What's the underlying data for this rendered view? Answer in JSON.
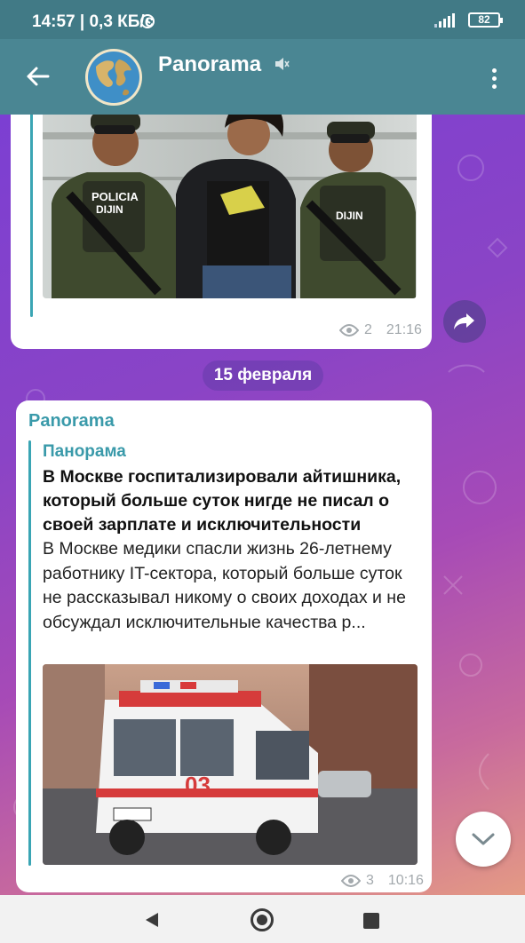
{
  "status_bar": {
    "time": "14:57 | 0,3 КБ/с",
    "battery": "82"
  },
  "header": {
    "title": "Panorama"
  },
  "messages": [
    {
      "views": "2",
      "time": "21:16"
    },
    {
      "forwarded_from": "Panorama",
      "source_name": "Панорама",
      "headline": "В Москве госпитализировали айтишника, который больше суток нигде не писал о своей зарплате и исключительности",
      "body": "В Москве медики спасли жизнь 26-летнему работнику IT-сектора, который больше суток не рассказывал никому о своих доходах и не обсуждал исключительные качества р...",
      "views": "3",
      "time": "10:16"
    }
  ],
  "date_separator": "15 февраля",
  "photo_labels": {
    "police_left": "POLICIA",
    "police_sub": "DIJIN",
    "police_right": "DIJIN",
    "ambulance_number": "03"
  },
  "colors": {
    "header": "#4a8693",
    "accent": "#3aa5b4"
  }
}
